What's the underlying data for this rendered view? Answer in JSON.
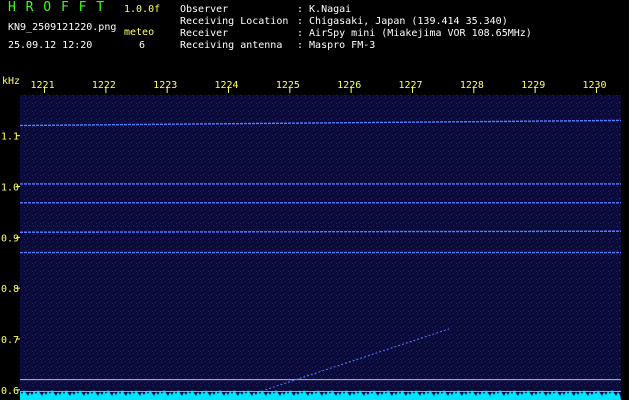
{
  "header": {
    "app_name": "H R O F F T",
    "version": "1.0.0f",
    "filename": "KN9_2509121220.png",
    "datetime": "25.09.12 12:20",
    "meteor_label": "meteo",
    "meteor_count": "6",
    "fields": [
      {
        "label": "Observer",
        "value": ": K.Nagai"
      },
      {
        "label": "Receiving Location",
        "value": ": Chigasaki, Japan (139.414 35.340)"
      },
      {
        "label": "Receiver",
        "value": ": AirSpy mini (Miakejima VOR 108.65MHz)"
      },
      {
        "label": "Receiving antenna",
        "value": ": Maspro FM-3"
      }
    ]
  },
  "colors": {
    "background": "#000000",
    "header_text": "#ffffff",
    "title": "#39ff14",
    "tick_text": "#ffff66",
    "plot_bg": "#0a0a3c",
    "signal": "#5a7dff",
    "baseline": "#00e5ff"
  },
  "chart_data": {
    "type": "heatmap",
    "ylabel": "kHz",
    "x_ticks": [
      "1221",
      "1222",
      "1223",
      "1224",
      "1225",
      "1226",
      "1227",
      "1228",
      "1229",
      "1230"
    ],
    "y_ticks": [
      1.1,
      1.0,
      0.9,
      0.8,
      0.7,
      0.6
    ],
    "y_tick_labels": [
      "1.1",
      "1.0",
      "0.9",
      "0.8",
      "0.7",
      "0.6"
    ],
    "xlim": [
      1220.6,
      1230.4
    ],
    "ylim": [
      0.58,
      1.18
    ],
    "signal_lines_khz": [
      {
        "y_start": 1.12,
        "y_end": 1.13
      },
      {
        "y_start": 1.005,
        "y_end": 1.005
      },
      {
        "y_start": 0.968,
        "y_end": 0.968
      },
      {
        "y_start": 0.91,
        "y_end": 0.912
      },
      {
        "y_start": 0.87,
        "y_end": 0.87
      }
    ],
    "reference_lines_khz": [
      0.62,
      0.597
    ],
    "meteor_trace": {
      "x_start": 1224.6,
      "y_start": 0.6,
      "x_end": 1227.6,
      "y_end": 0.72
    }
  }
}
